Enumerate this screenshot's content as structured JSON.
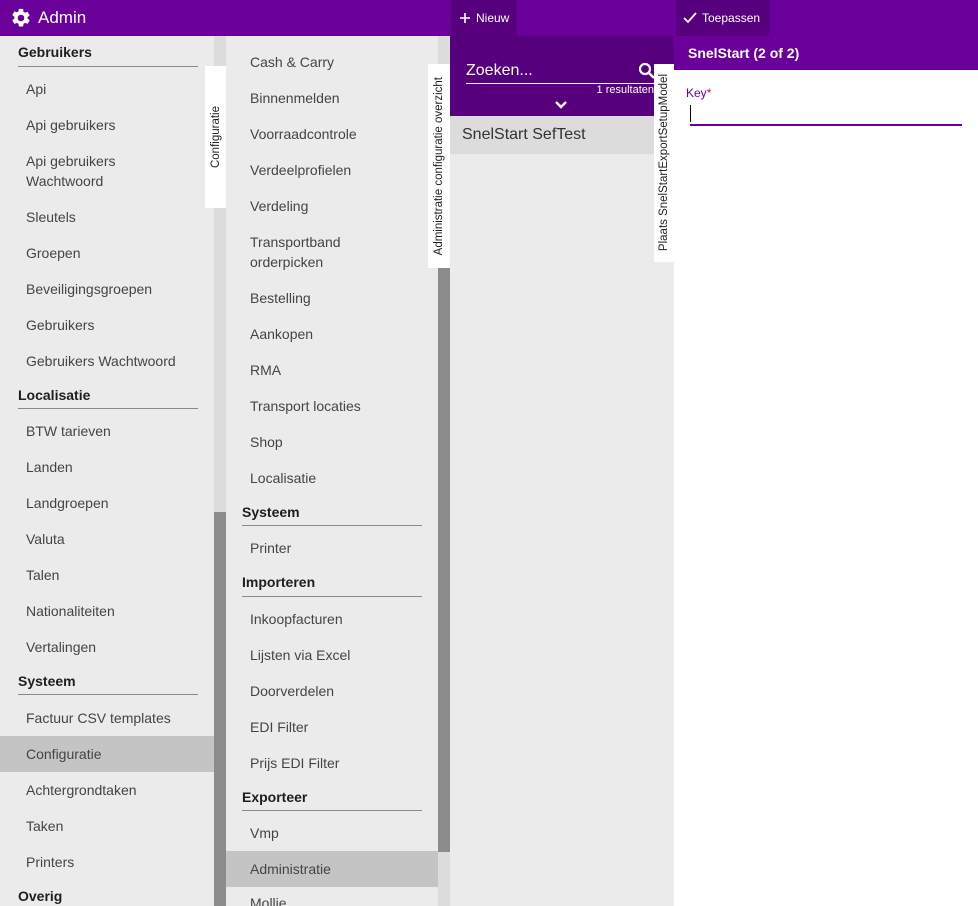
{
  "app": {
    "title": "Admin"
  },
  "toolbar": {
    "new_label": "Nieuw",
    "apply_label": "Toepassen"
  },
  "sidebar": {
    "tab_label": "Configuratie",
    "sections": [
      {
        "header": "Gebruikers",
        "items": [
          "Api",
          "Api gebruikers",
          "Api gebruikers\nWachtwoord",
          "Sleutels",
          "Groepen",
          "Beveiligingsgroepen",
          "Gebruikers",
          "Gebruikers Wachtwoord"
        ]
      },
      {
        "header": "Localisatie",
        "items": [
          "BTW tarieven",
          "Landen",
          "Landgroepen",
          "Valuta",
          "Talen",
          "Nationaliteiten",
          "Vertalingen"
        ]
      },
      {
        "header": "Systeem",
        "items": [
          "Factuur CSV templates",
          "Configuratie",
          "Achtergrondtaken",
          "Taken",
          "Printers"
        ]
      },
      {
        "header": "Overig",
        "items": []
      }
    ],
    "selected": "Configuratie"
  },
  "config_menu": {
    "tab_label": "Administratie configuratie overzicht",
    "top_items": [
      "Cash & Carry",
      "Binnenmelden",
      "Voorraadcontrole",
      "Verdeelprofielen",
      "Verdeling",
      "Transportband\norderpicken",
      "Bestelling",
      "Aankopen",
      "RMA",
      "Transport locaties",
      "Shop",
      "Localisatie"
    ],
    "sections": [
      {
        "header": "Systeem",
        "items": [
          "Printer"
        ]
      },
      {
        "header": "Importeren",
        "items": [
          "Inkoopfacturen",
          "Lijsten via Excel",
          "Doorverdelen",
          "EDI Filter",
          "Prijs EDI Filter"
        ]
      },
      {
        "header": "Exporteer",
        "items": [
          "Vmp",
          "Administratie",
          "Mollie"
        ]
      }
    ],
    "selected": "Administratie"
  },
  "list": {
    "tab_label": "Plaats SnelStartExportSetupModel",
    "search_placeholder": "Zoeken...",
    "result_count": "1 resultaten",
    "results": [
      "SnelStart SefTest"
    ]
  },
  "detail": {
    "title": "SnelStart (2 of 2)",
    "key_label": "Key",
    "required_mark": "*",
    "key_value": ""
  },
  "colors": {
    "brand": "#6a0099",
    "brand_dark": "#56007e",
    "panel_bg": "#ebebeb",
    "selected_bg": "#c4c4c4"
  }
}
